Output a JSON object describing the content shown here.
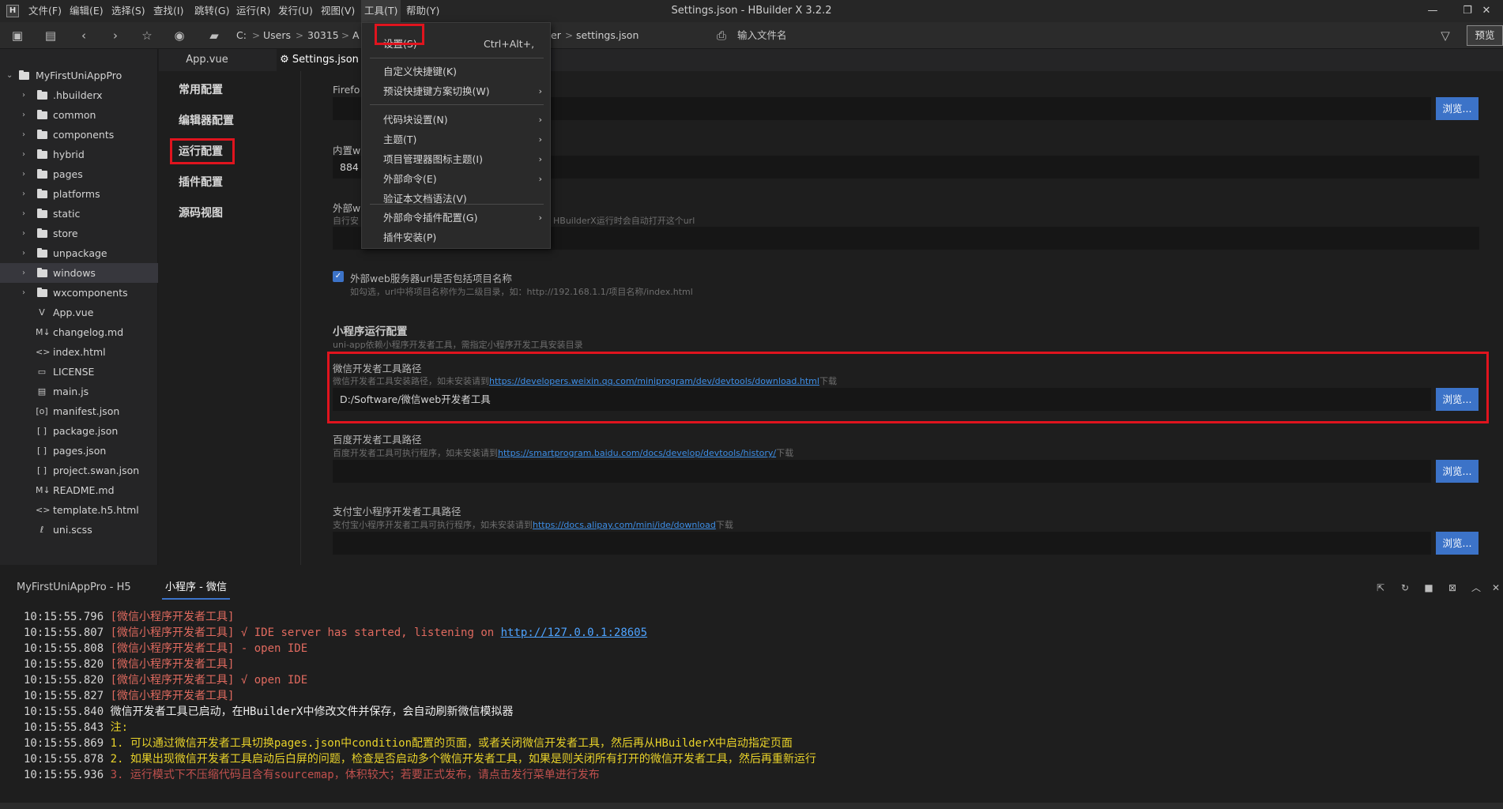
{
  "titlebar": {
    "menus": [
      "文件(F)",
      "编辑(E)",
      "选择(S)",
      "查找(I)",
      "跳转(G)",
      "运行(R)",
      "发行(U)",
      "视图(V)",
      "工具(T)",
      "帮助(Y)"
    ],
    "title": "Settings.json - HBuilder X 3.2.2"
  },
  "toolbar": {
    "breadcrumb": [
      "C:",
      "Users",
      "30315",
      "A",
      "er",
      "settings.json"
    ],
    "file_search_placeholder": "输入文件名",
    "preview_label": "预览"
  },
  "sidebar": {
    "project": "MyFirstUniAppPro",
    "items": [
      {
        "name": ".hbuilderx",
        "type": "folder"
      },
      {
        "name": "common",
        "type": "folder"
      },
      {
        "name": "components",
        "type": "folder"
      },
      {
        "name": "hybrid",
        "type": "folder"
      },
      {
        "name": "pages",
        "type": "folder"
      },
      {
        "name": "platforms",
        "type": "folder"
      },
      {
        "name": "static",
        "type": "folder"
      },
      {
        "name": "store",
        "type": "folder"
      },
      {
        "name": "unpackage",
        "type": "folder"
      },
      {
        "name": "windows",
        "type": "folder"
      },
      {
        "name": "wxcomponents",
        "type": "folder"
      },
      {
        "name": "App.vue",
        "type": "vue"
      },
      {
        "name": "changelog.md",
        "type": "md"
      },
      {
        "name": "index.html",
        "type": "html"
      },
      {
        "name": "LICENSE",
        "type": "file"
      },
      {
        "name": "main.js",
        "type": "js"
      },
      {
        "name": "manifest.json",
        "type": "manifest"
      },
      {
        "name": "package.json",
        "type": "json"
      },
      {
        "name": "pages.json",
        "type": "json"
      },
      {
        "name": "project.swan.json",
        "type": "json"
      },
      {
        "name": "README.md",
        "type": "md"
      },
      {
        "name": "template.h5.html",
        "type": "html"
      },
      {
        "name": "uni.scss",
        "type": "scss"
      }
    ]
  },
  "tabs": [
    "App.vue",
    "Settings.json"
  ],
  "settings_nav": [
    "常用配置",
    "编辑器配置",
    "运行配置",
    "插件配置",
    "源码视图"
  ],
  "settings": {
    "firefox_label": "Firefo",
    "builtin_label": "内置w",
    "builtin_value": "884",
    "external_label": "外部w",
    "external_hint_a": "自行安",
    "external_hint_b": "HBuilderX运行时会自动打开这个url",
    "external_check_label": "外部web服务器url是否包括项目名称",
    "external_check_hint": "如勾选，url中将项目名称作为二级目录，如：http://192.168.1.1/项目名称/index.html",
    "mp_title": "小程序运行配置",
    "mp_hint": "uni-app依赖小程序开发者工具，需指定小程序开发工具安装目录",
    "wechat_label": "微信开发者工具路径",
    "wechat_hint_prefix": "微信开发者工具安装路径，如未安装请到",
    "wechat_link": "https://developers.weixin.qq.com/miniprogram/dev/devtools/download.html",
    "wechat_hint_suffix": "下载",
    "wechat_value": "D:/Software/微信web开发者工具",
    "baidu_label": "百度开发者工具路径",
    "baidu_hint_prefix": "百度开发者工具可执行程序，如未安装请到",
    "baidu_link": "https://smartprogram.baidu.com/docs/develop/devtools/history/",
    "baidu_hint_suffix": "下载",
    "alipay_label": "支付宝小程序开发者工具路径",
    "alipay_hint_prefix": "支付宝小程序开发者工具可执行程序，如未安装请到",
    "alipay_link": "https://docs.alipay.com/mini/ide/download",
    "alipay_hint_suffix": "下载",
    "browse_label": "浏览..."
  },
  "dropdown": {
    "items": [
      {
        "label": "设置(S)",
        "shortcut": "Ctrl+Alt+,",
        "submenu": false
      },
      {
        "label": "自定义快捷键(K)",
        "submenu": false
      },
      {
        "label": "预设快捷键方案切换(W)",
        "submenu": true
      },
      {
        "label": "代码块设置(N)",
        "submenu": true
      },
      {
        "label": "主题(T)",
        "submenu": true
      },
      {
        "label": "项目管理器图标主题(I)",
        "submenu": true
      },
      {
        "label": "外部命令(E)",
        "submenu": true
      },
      {
        "label": "验证本文档语法(V)",
        "submenu": false
      },
      {
        "label": "外部命令插件配置(G)",
        "submenu": true
      },
      {
        "label": "插件安装(P)",
        "submenu": false
      }
    ]
  },
  "console": {
    "tabs": [
      "MyFirstUniAppPro - H5",
      "小程序 - 微信"
    ],
    "lines": [
      {
        "time": "10:15:55.796",
        "tag": "[微信小程序开发者工具]",
        "text": "",
        "cls": "tag"
      },
      {
        "time": "10:15:55.807",
        "tag": "[微信小程序开发者工具]",
        "text": " √ IDE server has started, listening on ",
        "link": "http://127.0.0.1:28605",
        "cls": "tag"
      },
      {
        "time": "10:15:55.808",
        "tag": "[微信小程序开发者工具]",
        "text": " - open IDE",
        "cls": "tag"
      },
      {
        "time": "10:15:55.820",
        "tag": "[微信小程序开发者工具]",
        "text": "",
        "cls": "tag"
      },
      {
        "time": "10:15:55.820",
        "tag": "[微信小程序开发者工具]",
        "text": " √ open IDE",
        "cls": "tag"
      },
      {
        "time": "10:15:55.827",
        "tag": "[微信小程序开发者工具]",
        "text": "",
        "cls": "tag"
      },
      {
        "time": "10:15:55.840",
        "tag": "",
        "text": "微信开发者工具已启动，在HBuilderX中修改文件并保存，会自动刷新微信模拟器",
        "cls": "white"
      },
      {
        "time": "10:15:55.843",
        "tag": "",
        "text": "注:",
        "cls": "yellow"
      },
      {
        "time": "10:15:55.869",
        "tag": "",
        "text": "1. 可以通过微信开发者工具切换pages.json中condition配置的页面，或者关闭微信开发者工具，然后再从HBuilderX中启动指定页面",
        "cls": "yellow"
      },
      {
        "time": "10:15:55.878",
        "tag": "",
        "text": "2. 如果出现微信开发者工具启动后白屏的问题，检查是否启动多个微信开发者工具，如果是则关闭所有打开的微信开发者工具，然后再重新运行",
        "cls": "yellow"
      },
      {
        "time": "10:15:55.936",
        "tag": "",
        "text": "3. 运行模式下不压缩代码且含有sourcemap，体积较大；若要正式发布，请点击发行菜单进行发布",
        "cls": "dimred"
      }
    ]
  },
  "colors": {
    "accent": "#3c73c8",
    "highlight": "#e0141e",
    "warn": "#e9d32a",
    "tag": "#e06a5f"
  }
}
